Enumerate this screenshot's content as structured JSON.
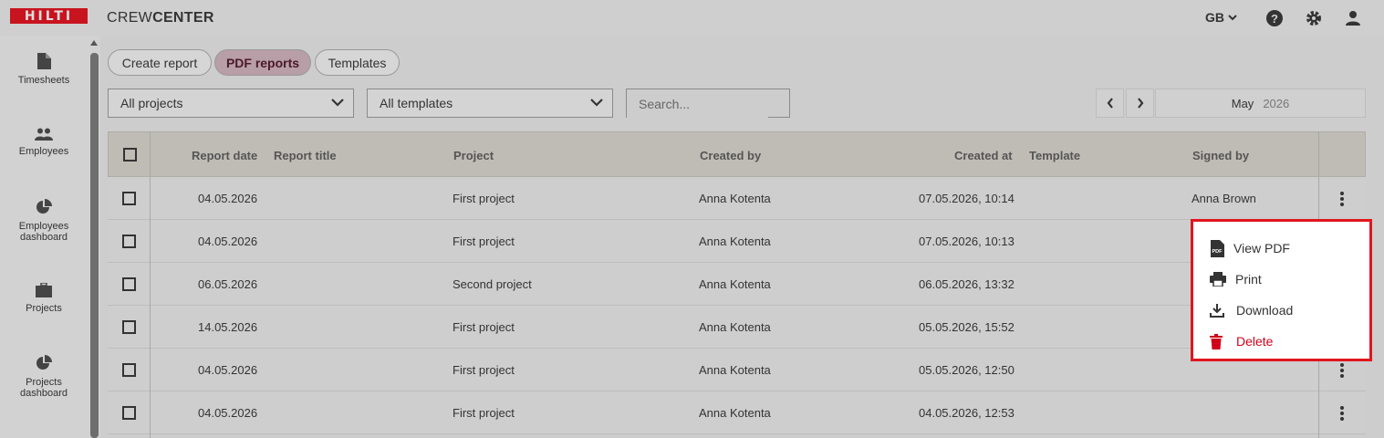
{
  "header": {
    "logo_text": "HILTI",
    "app_name_light": "CREW",
    "app_name_bold": "CENTER",
    "language": "GB",
    "icons": [
      "help-icon",
      "gear-icon",
      "user-icon"
    ]
  },
  "sidebar": {
    "items": [
      {
        "label": "Timesheets",
        "icon": "document-icon"
      },
      {
        "label": "Employees",
        "icon": "people-icon"
      },
      {
        "label": "Employees\ndashboard",
        "icon": "pie-chart-icon"
      },
      {
        "label": "Projects",
        "icon": "briefcase-icon"
      },
      {
        "label": "Projects\ndashboard",
        "icon": "pie-chart-icon"
      }
    ]
  },
  "tabs": [
    {
      "label": "Create report",
      "active": false
    },
    {
      "label": "PDF reports",
      "active": true
    },
    {
      "label": "Templates",
      "active": false
    }
  ],
  "filters": {
    "projects": "All projects",
    "templates": "All templates",
    "search_placeholder": "Search...",
    "month": "May",
    "year": "2026"
  },
  "table": {
    "columns": [
      "Report date",
      "Report title",
      "Project",
      "Created by",
      "Created at",
      "Template",
      "Signed by"
    ],
    "rows": [
      {
        "report_date": "04.05.2026",
        "report_title": "",
        "project": "First project",
        "created_by": "Anna Kotenta",
        "created_at": "07.05.2026, 10:14",
        "template": "",
        "signed_by": "Anna Brown"
      },
      {
        "report_date": "04.05.2026",
        "report_title": "",
        "project": "First project",
        "created_by": "Anna Kotenta",
        "created_at": "07.05.2026, 10:13",
        "template": "",
        "signed_by": ""
      },
      {
        "report_date": "06.05.2026",
        "report_title": "",
        "project": "Second project",
        "created_by": "Anna Kotenta",
        "created_at": "06.05.2026, 13:32",
        "template": "",
        "signed_by": ""
      },
      {
        "report_date": "14.05.2026",
        "report_title": "",
        "project": "First project",
        "created_by": "Anna Kotenta",
        "created_at": "05.05.2026, 15:52",
        "template": "",
        "signed_by": ""
      },
      {
        "report_date": "04.05.2026",
        "report_title": "",
        "project": "First project",
        "created_by": "Anna Kotenta",
        "created_at": "05.05.2026, 12:50",
        "template": "",
        "signed_by": ""
      },
      {
        "report_date": "04.05.2026",
        "report_title": "",
        "project": "First project",
        "created_by": "Anna Kotenta",
        "created_at": "04.05.2026, 12:53",
        "template": "",
        "signed_by": ""
      }
    ]
  },
  "context_menu": {
    "items": [
      {
        "label": "View PDF",
        "icon": "pdf-icon"
      },
      {
        "label": "Print",
        "icon": "printer-icon"
      },
      {
        "label": "Download",
        "icon": "download-icon"
      },
      {
        "label": "Delete",
        "icon": "trash-icon"
      }
    ],
    "highlight_color": "#e0161e",
    "danger_color": "#d0021b"
  },
  "colors": {
    "brand_red": "#c8141e",
    "active_tab": "#b89ea6"
  }
}
